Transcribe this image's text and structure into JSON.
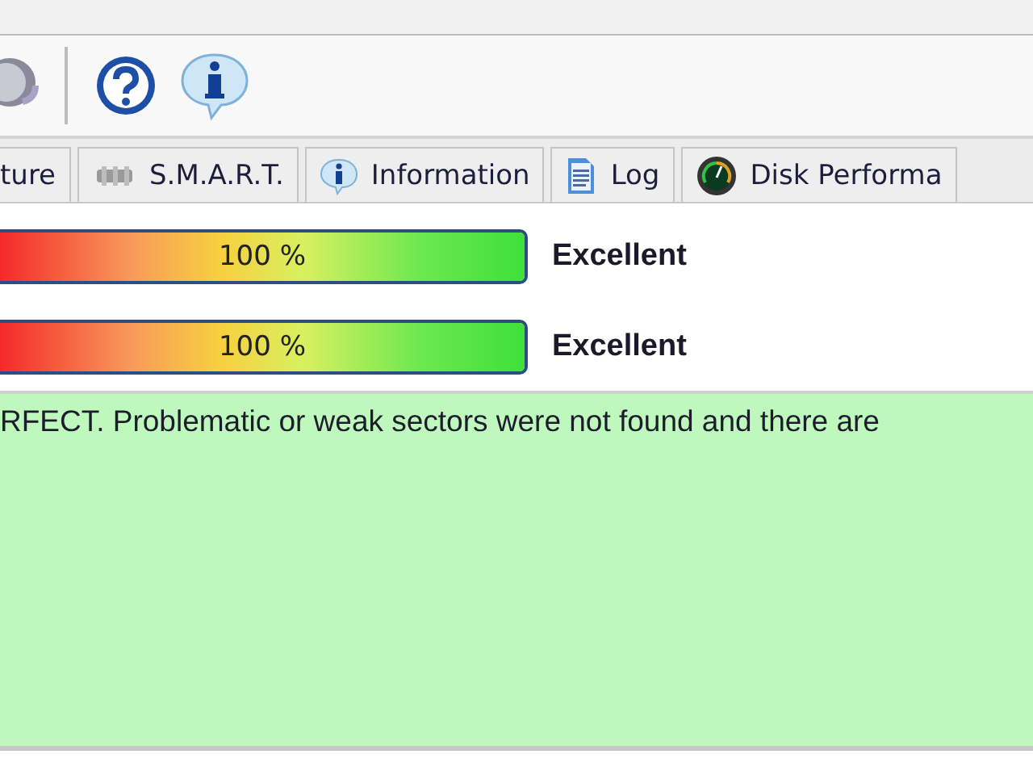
{
  "toolbar": {
    "buttons": [
      {
        "kind": "speaker"
      },
      {
        "kind": "separator"
      },
      {
        "kind": "help"
      },
      {
        "kind": "info"
      }
    ]
  },
  "tabs": [
    {
      "label": "ture",
      "kind": "plain",
      "selected": false
    },
    {
      "label": "S.M.A.R.T.",
      "kind": "smart",
      "selected": false
    },
    {
      "label": "Information",
      "kind": "information",
      "selected": false
    },
    {
      "label": "Log",
      "kind": "log",
      "selected": false
    },
    {
      "label": "Disk Performa",
      "kind": "performance",
      "selected": false
    }
  ],
  "meters": [
    {
      "level": 1.0,
      "reading": "100 %",
      "rating": "Excellent"
    },
    {
      "level": 1.0,
      "reading": "100 %",
      "rating": "Excellent"
    }
  ],
  "message": "RFECT. Problematic or weak sectors were not found and there are"
}
